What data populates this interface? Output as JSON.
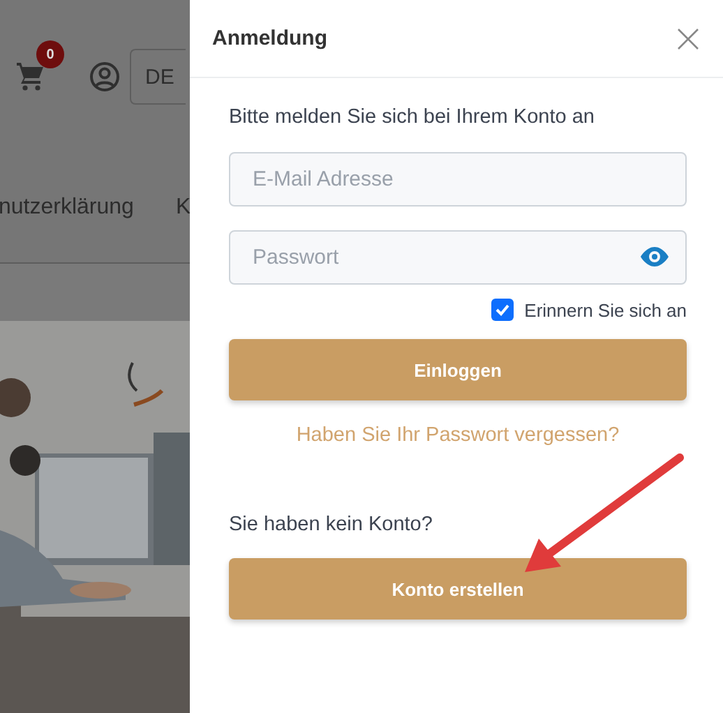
{
  "background": {
    "cart_count": "0",
    "language": "DE",
    "nav_items": [
      "nutzerklärung",
      "K"
    ]
  },
  "panel": {
    "title": "Anmeldung",
    "intro": "Bitte melden Sie sich bei Ihrem Konto an",
    "email": {
      "placeholder": "E-Mail Adresse"
    },
    "password": {
      "placeholder": "Passwort"
    },
    "remember": {
      "label": "Erinnern Sie sich an",
      "checked": true
    },
    "login_button": "Einloggen",
    "forgot_link": "Haben Sie Ihr Passwort vergessen?",
    "no_account": "Sie haben kein Konto?",
    "create_button": "Konto erstellen"
  }
}
